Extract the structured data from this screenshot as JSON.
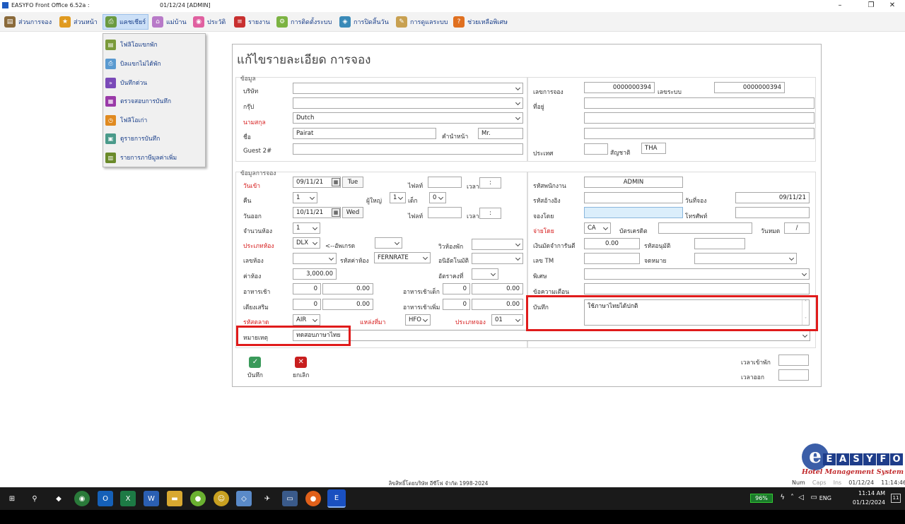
{
  "titlebar": {
    "app": "EASYFO Front Office 6.52a :",
    "info": "01/12/24 [ADMIN]",
    "minimize": "–",
    "maximize": "❐",
    "close": "✕"
  },
  "menu": [
    {
      "label": "ส่วนการจอง",
      "icon": "book-icon",
      "color": "#8a6a3a"
    },
    {
      "label": "ส่วนหน้า",
      "icon": "star-icon",
      "color": "#e09a20"
    },
    {
      "label": "แคชเชียร์",
      "icon": "printer-icon",
      "color": "#6a9a40"
    },
    {
      "label": "แม่บ้าน",
      "icon": "housekeeping-icon",
      "color": "#b87ac8"
    },
    {
      "label": "ประวัติ",
      "icon": "history-icon",
      "color": "#e060a0"
    },
    {
      "label": "รายงาน",
      "icon": "report-icon",
      "color": "#c83030"
    },
    {
      "label": "การติดตั้งระบบ",
      "icon": "gear-icon",
      "color": "#7cb342"
    },
    {
      "label": "การปิดสิ้นวัน",
      "icon": "shield-icon",
      "color": "#3a8ab8"
    },
    {
      "label": "การดูแลระบบ",
      "icon": "wrench-icon",
      "color": "#c8a050"
    },
    {
      "label": "ช่วยเหลือพิเศษ",
      "icon": "help-icon",
      "color": "#e07020"
    }
  ],
  "dropdown": [
    {
      "label": "โฟลิโอแขกพัก",
      "icon": "folio-icon",
      "color": "#7a9a3a"
    },
    {
      "label": "บิลแขกไม่ได้พัก",
      "icon": "printer-icon",
      "color": "#5a9ad0"
    },
    {
      "label": "บันทึกด่วน",
      "icon": "fast-forward-icon",
      "color": "#7a4ab8"
    },
    {
      "label": "ตรวจสอบการบันทึก",
      "icon": "document-check-icon",
      "color": "#9a3aa8"
    },
    {
      "label": "โฟลิโอเก่า",
      "icon": "clock-icon",
      "color": "#e08a20"
    },
    {
      "label": "ดูรายการบันทึก",
      "icon": "view-list-icon",
      "color": "#4a9a8a"
    },
    {
      "label": "รายการภาษีมูลค่าเพิ่ม",
      "icon": "tax-list-icon",
      "color": "#6a8a2a"
    }
  ],
  "form": {
    "title": "แก้ไขรายละเอียด การจอง",
    "guest": {
      "section": "ข้อมูล",
      "company_label": "บริษัท",
      "company": "",
      "group_label": "กรุ๊ป",
      "group": "",
      "surname_label": "นามสกุล",
      "surname": "Dutch",
      "name_label": "ชื่อ",
      "name": "Pairat",
      "prefix_label": "คำนำหน้า",
      "prefix": "Mr.",
      "guest2_label": "Guest 2#",
      "guest2": "",
      "booking_no_label": "เลขการจอง",
      "booking_no": "0000000394",
      "system_no_label": "เลขระบบ",
      "system_no": "0000000394",
      "address_label": "ที่อยู่",
      "address1": "",
      "address2": "",
      "address3": "",
      "country_label": "ประเทศ",
      "country": "",
      "nationality_label": "สัญชาติ",
      "nationality": "THA"
    },
    "booking": {
      "section": "ข้อมูลการจอง",
      "checkin_label": "วันเข้า",
      "checkin": "09/11/21",
      "checkin_day": "Tue",
      "flight_label": "ไฟลท์",
      "flight_in": "",
      "time_label": "เวลา",
      "time_in": ":",
      "nights_label": "คืน",
      "nights": "1",
      "adults_label": "ผู้ใหญ่",
      "adults": "1",
      "children_label": "เด็ก",
      "children": "0",
      "checkout_label": "วันออก",
      "checkout": "10/11/21",
      "checkout_day": "Wed",
      "flight_out": "",
      "time_out": ":",
      "rooms_label": "จำนวนห้อง",
      "rooms": "1",
      "roomtype_label": "ประเภทห้อง",
      "roomtype": "DLX",
      "upgrade_label": "<--อัพเกรด",
      "upgrade": "",
      "view_label": "วิวห้องพัก",
      "view": "",
      "roomno_label": "เลขห้อง",
      "roomno": "",
      "ratecode_label": "รหัสค่าห้อง",
      "ratecode": "FERNRATE",
      "auto_label": "อนิอัตโนมัติ",
      "auto": "",
      "rate_label": "ค่าห้อง",
      "rate": "3,000.00",
      "fixedrate_label": "อัตราคงที่",
      "fixedrate": "",
      "breakfast_label": "อาหารเช้า",
      "breakfast_qty": "0",
      "breakfast_amt": "0.00",
      "childbf_label": "อาหารเช้าเด็ก",
      "childbf_qty": "0",
      "childbf_amt": "0.00",
      "extrabed_label": "เตียงเสริม",
      "extrabed_qty": "0",
      "extrabed_amt": "0.00",
      "extrabf_label": "อาหารเช้าเพิ่ม",
      "extrabf_qty": "0",
      "extrabf_amt": "0.00",
      "market_label": "รหัสตลาด",
      "market": "AIR",
      "source_label": "แหล่งที่มา",
      "source": "HFO",
      "bktype_label": "ประเภทจอง",
      "bktype": "01",
      "remark_label": "หมายเหตุ",
      "remark": "ทดสอบภาษาไทย"
    },
    "staff": {
      "staff_label": "รหัสพนักงาน",
      "staff": "ADMIN",
      "ref_label": "รหัสอ้างอิง",
      "ref": "",
      "bookdate_label": "วันที่จอง",
      "bookdate": "09/11/21",
      "bookby_label": "จองโดย",
      "bookby": "",
      "phone_label": "โทรศัพท์",
      "phone": "",
      "payby_label": "จ่ายโดย",
      "payby": "CA",
      "card_label": "บัตรเครดิต",
      "card": "",
      "expiry_label": "วันหมด",
      "expiry": "/",
      "deposit_label": "เงินมัดจำการันตี",
      "deposit": "0.00",
      "approve_label": "รหัสอนุมัติ",
      "approve": "",
      "tm_label": "เลข TM",
      "tm": "",
      "letter_label": "จดหมาย",
      "letter": "",
      "special_label": "พิเศษ",
      "special": "",
      "alert_label": "ข้อความเตือน",
      "alert": "",
      "note_label": "บันทึก",
      "note": "ใช้ภาษาไทยได้ปกติ"
    },
    "buttons": {
      "save": "บันทึก",
      "cancel": "ยกเลิก"
    },
    "times": {
      "in_label": "เวลาเข้าพัก",
      "in": "",
      "out_label": "เวลาออก",
      "out": ""
    }
  },
  "copyright": "ลิขสิทธิ์โดยบริษัท อีซีโฟ จำกัด 1998-2024",
  "logo": {
    "letters": [
      "E",
      "A",
      "S",
      "Y",
      "F",
      "O"
    ],
    "mark": "e",
    "tagline": "Hotel Management System"
  },
  "status": {
    "num": "Num",
    "caps": "Caps",
    "ins": "Ins",
    "date": "01/12/24",
    "time": "11:14:46"
  },
  "taskbar": {
    "battery": "96%",
    "lang": "ENG",
    "time": "11:14 AM",
    "date": "01/12/2024",
    "notif": "11"
  }
}
